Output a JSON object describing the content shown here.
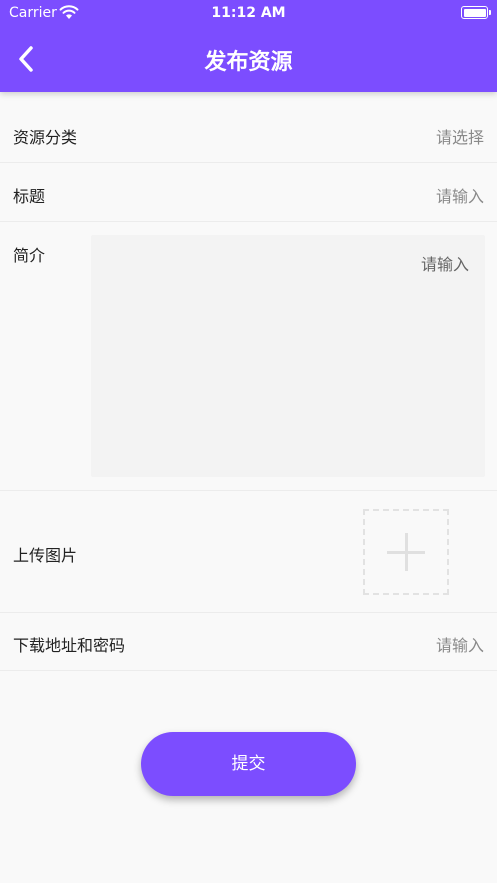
{
  "status_bar": {
    "carrier": "Carrier",
    "time": "11:12 AM",
    "wifi_icon": "wifi-icon",
    "battery_icon": "battery-icon"
  },
  "nav": {
    "title": "发布资源",
    "back_icon": "chevron-left-icon"
  },
  "form": {
    "category": {
      "label": "资源分类",
      "placeholder": "请选择"
    },
    "title": {
      "label": "标题",
      "placeholder": "请输入"
    },
    "intro": {
      "label": "简介",
      "placeholder": "请输入"
    },
    "upload": {
      "label": "上传图片",
      "icon": "plus-icon"
    },
    "download": {
      "label": "下载地址和密码",
      "placeholder": "请输入"
    }
  },
  "submit": {
    "label": "提交"
  },
  "colors": {
    "accent": "#7c4dff",
    "background": "#f9f9f9",
    "placeholder": "#8a8a8a"
  }
}
